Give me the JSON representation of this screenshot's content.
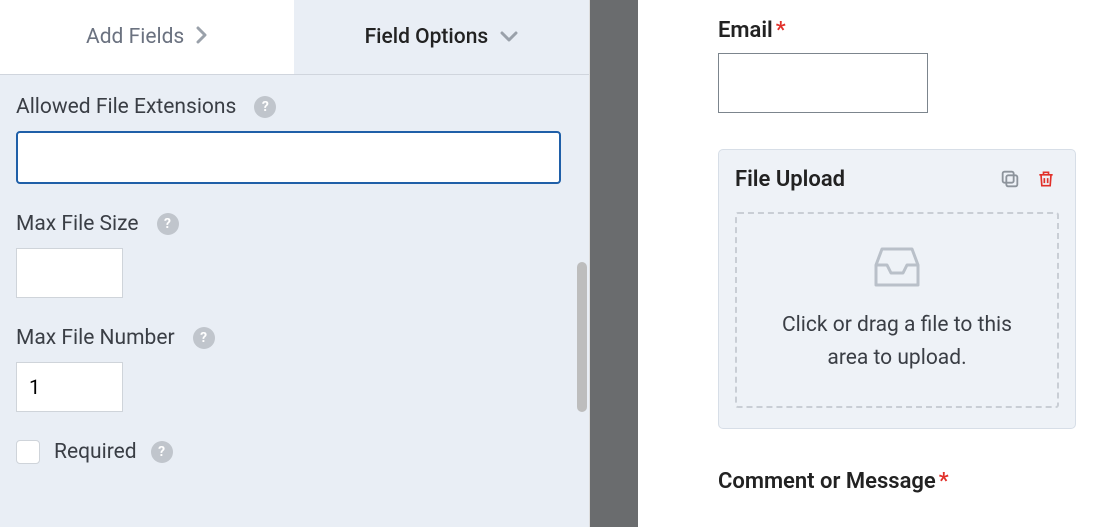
{
  "tabs": {
    "add_fields": "Add Fields",
    "field_options": "Field Options"
  },
  "options": {
    "allowed_ext": {
      "label": "Allowed File Extensions",
      "value": ""
    },
    "max_size": {
      "label": "Max File Size",
      "value": ""
    },
    "max_number": {
      "label": "Max File Number",
      "value": "1"
    },
    "required": {
      "label": "Required",
      "checked": false
    }
  },
  "preview": {
    "email": {
      "label": "Email",
      "required": true,
      "value": ""
    },
    "upload": {
      "label": "File Upload",
      "dropzone_text": "Click or drag a file to this area to upload."
    },
    "comment": {
      "label": "Comment or Message",
      "required": true
    }
  },
  "glyphs": {
    "required_mark": "*",
    "help": "?"
  }
}
